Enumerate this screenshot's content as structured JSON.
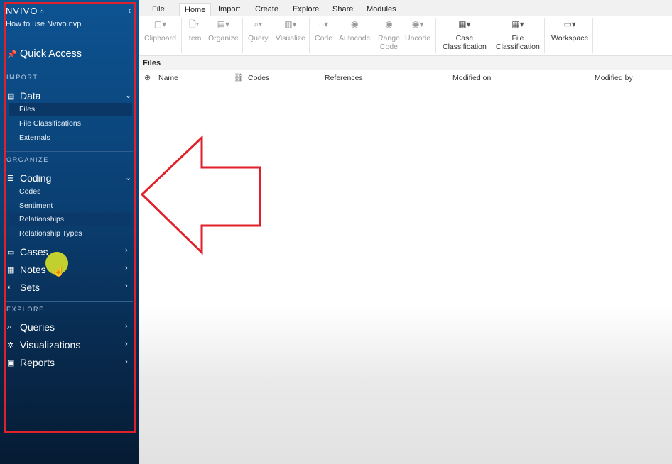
{
  "app": {
    "logo": "NVIVO",
    "logo_mark": "⁘",
    "project": "How to use Nvivo.nvp",
    "collapse_icon": "‹"
  },
  "sidebar": {
    "quick_access": "Quick Access",
    "sections": {
      "import": "IMPORT",
      "organize": "ORGANIZE",
      "explore": "EXPLORE"
    },
    "data": {
      "label": "Data",
      "items": [
        "Files",
        "File Classifications",
        "Externals"
      ]
    },
    "coding": {
      "label": "Coding",
      "items": [
        "Codes",
        "Sentiment",
        "Relationships",
        "Relationship Types"
      ]
    },
    "cases": "Cases",
    "notes": "Notes",
    "sets": "Sets",
    "queries": "Queries",
    "visualizations": "Visualizations",
    "reports": "Reports",
    "chevron_down": "⌄",
    "chevron_right": "›"
  },
  "menu_tabs": [
    "File",
    "Home",
    "Import",
    "Create",
    "Explore",
    "Share",
    "Modules"
  ],
  "active_tab": "Home",
  "ribbon": {
    "clipboard": "Clipboard",
    "item": "Item",
    "organize": "Organize",
    "query": "Query",
    "visualize": "Visualize",
    "code": "Code",
    "autocode": "Autocode",
    "range_code": [
      "Range",
      "Code"
    ],
    "uncode": "Uncode",
    "case_classification": [
      "Case",
      "Classification"
    ],
    "file_classification": [
      "File",
      "Classification"
    ],
    "workspace": "Workspace"
  },
  "files_panel": {
    "title": "Files",
    "columns": [
      "Name",
      "Codes",
      "References",
      "Modified on",
      "Modified by"
    ]
  },
  "colors": {
    "sidebar_top": "#0d5392",
    "sidebar_bottom": "#061b33",
    "annotation_red": "#e0202a",
    "cursor_highlight": "#dce628"
  }
}
